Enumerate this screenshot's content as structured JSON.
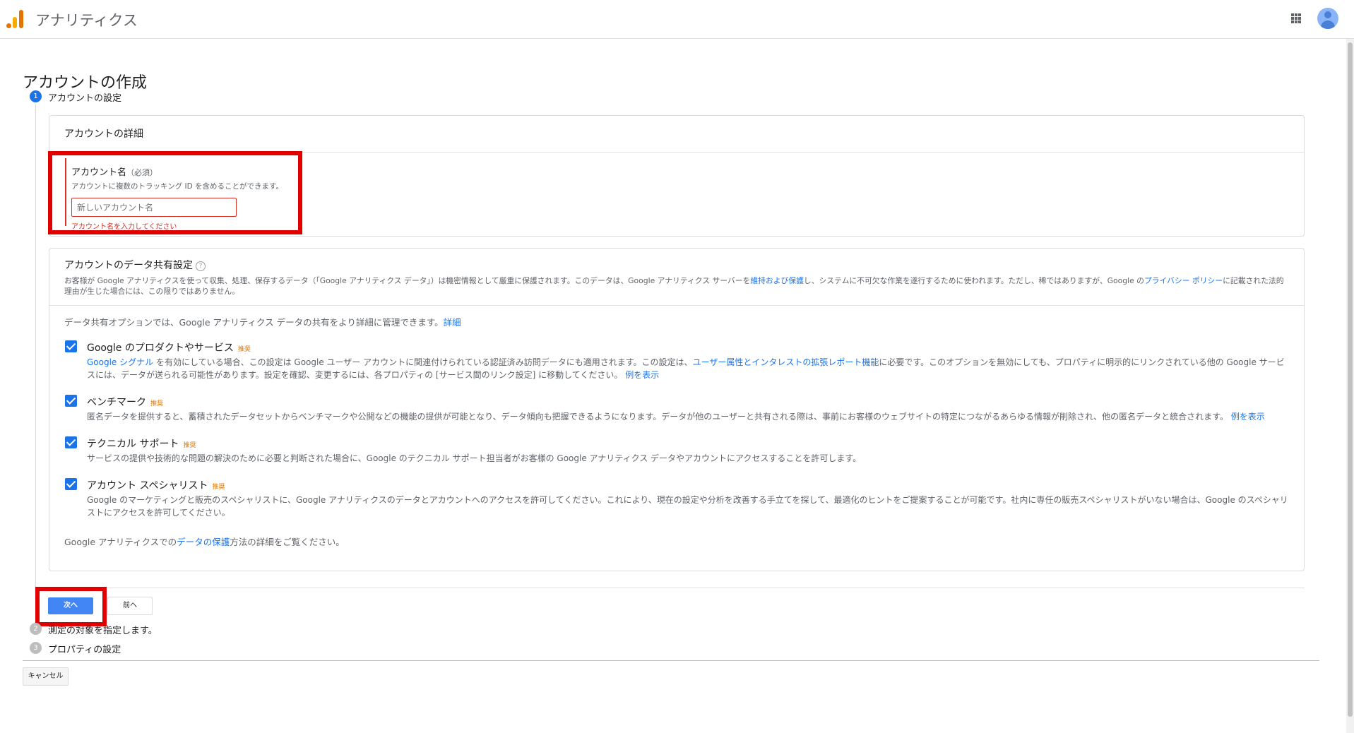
{
  "appbar": {
    "title": "アナリティクス",
    "icons": [
      "analytics-logo",
      "apps-grid-icon",
      "account-avatar"
    ]
  },
  "page": {
    "title": "アカウントの作成"
  },
  "steps": [
    {
      "number": "1",
      "label": "アカウントの設定"
    },
    {
      "number": "2",
      "label": "測定の対象を指定します。"
    },
    {
      "number": "3",
      "label": "プロパティの設定"
    }
  ],
  "account_card": {
    "heading": "アカウントの詳細",
    "field_label": "アカウント名",
    "field_required": "（必須）",
    "field_hint": "アカウントに複数のトラッキング ID を含めることができます。",
    "field_value": "",
    "field_placeholder": "新しいアカウント名",
    "field_error": "アカウント名を入力してください"
  },
  "share_card": {
    "title": "アカウントのデータ共有設定",
    "help": "?",
    "desc_1": "お客様が Google アナリティクスを使って収集、処理、保存するデータ（「Google アナリティクス データ」）は機密情報として厳重に保護されます。このデータは、Google アナリティクス サーバーを",
    "desc_link_1": "維持および保護",
    "desc_2": "し、システムに不可欠な作業を遂行するために使われます。ただし、稀ではありますが、Google の",
    "desc_link_2": "プライバシー ポリシー",
    "desc_3": "に記載された法的理由が生じた場合には、この限りではありません。",
    "intro": "データ共有オプションでは、Google アナリティクス データの共有をより詳細に管理できます。",
    "intro_link": "詳細",
    "recommended": "推奨",
    "options": [
      {
        "title": "Google のプロダクトやサービス",
        "checked": true,
        "link_a": "Google シグナル",
        "text_a": " を有効にしている場合、この設定は Google ユーザー アカウントに関連付けられている認証済み訪問データにも適用されます。この設定は、",
        "link_b": "ユーザー属性とインタレストの拡張レポート機能",
        "text_b": "に必要です。このオプションを無効にしても、プロパティに明示的にリンクされている他の Google サービスには、データが送られる可能性があります。設定を確認、変更するには、各プロパティの [サービス間のリンク設定] に移動してください。",
        "link_c": "例を表示"
      },
      {
        "title": "ベンチマーク",
        "checked": true,
        "text_a": "匿名データを提供すると、蓄積されたデータセットからベンチマークや公開などの機能の提供が可能となり、データ傾向も把握できるようになります。データが他のユーザーと共有される際は、事前にお客様のウェブサイトの特定につながるあらゆる情報が削除され、他の匿名データと統合されます。",
        "link_c": "例を表示"
      },
      {
        "title": "テクニカル サポート",
        "checked": true,
        "text_a": "サービスの提供や技術的な問題の解決のために必要と判断された場合に、Google のテクニカル サポート担当者がお客様の Google アナリティクス データやアカウントにアクセスすることを許可します。"
      },
      {
        "title": "アカウント スペシャリスト",
        "checked": true,
        "text_a": "Google のマーケティングと販売のスペシャリストに、Google アナリティクスのデータとアカウントへのアクセスを許可してください。これにより、現在の設定や分析を改善する手立てを探して、最適化のヒントをご提案することが可能です。社内に専任の販売スペシャリストがいない場合は、Google のスペシャリストにアクセスを許可してください。"
      }
    ],
    "footer_1": "Google アナリティクスでの",
    "footer_link": "データの保護",
    "footer_2": "方法の詳細をご覧ください。"
  },
  "buttons": {
    "next": "次へ",
    "prev": "前へ",
    "cancel": "キャンセル"
  },
  "colors": {
    "accent": "#1a73e8",
    "button_primary": "#4285f4",
    "error": "#d93025",
    "highlight": "#e00000",
    "recommended": "#e37400"
  }
}
